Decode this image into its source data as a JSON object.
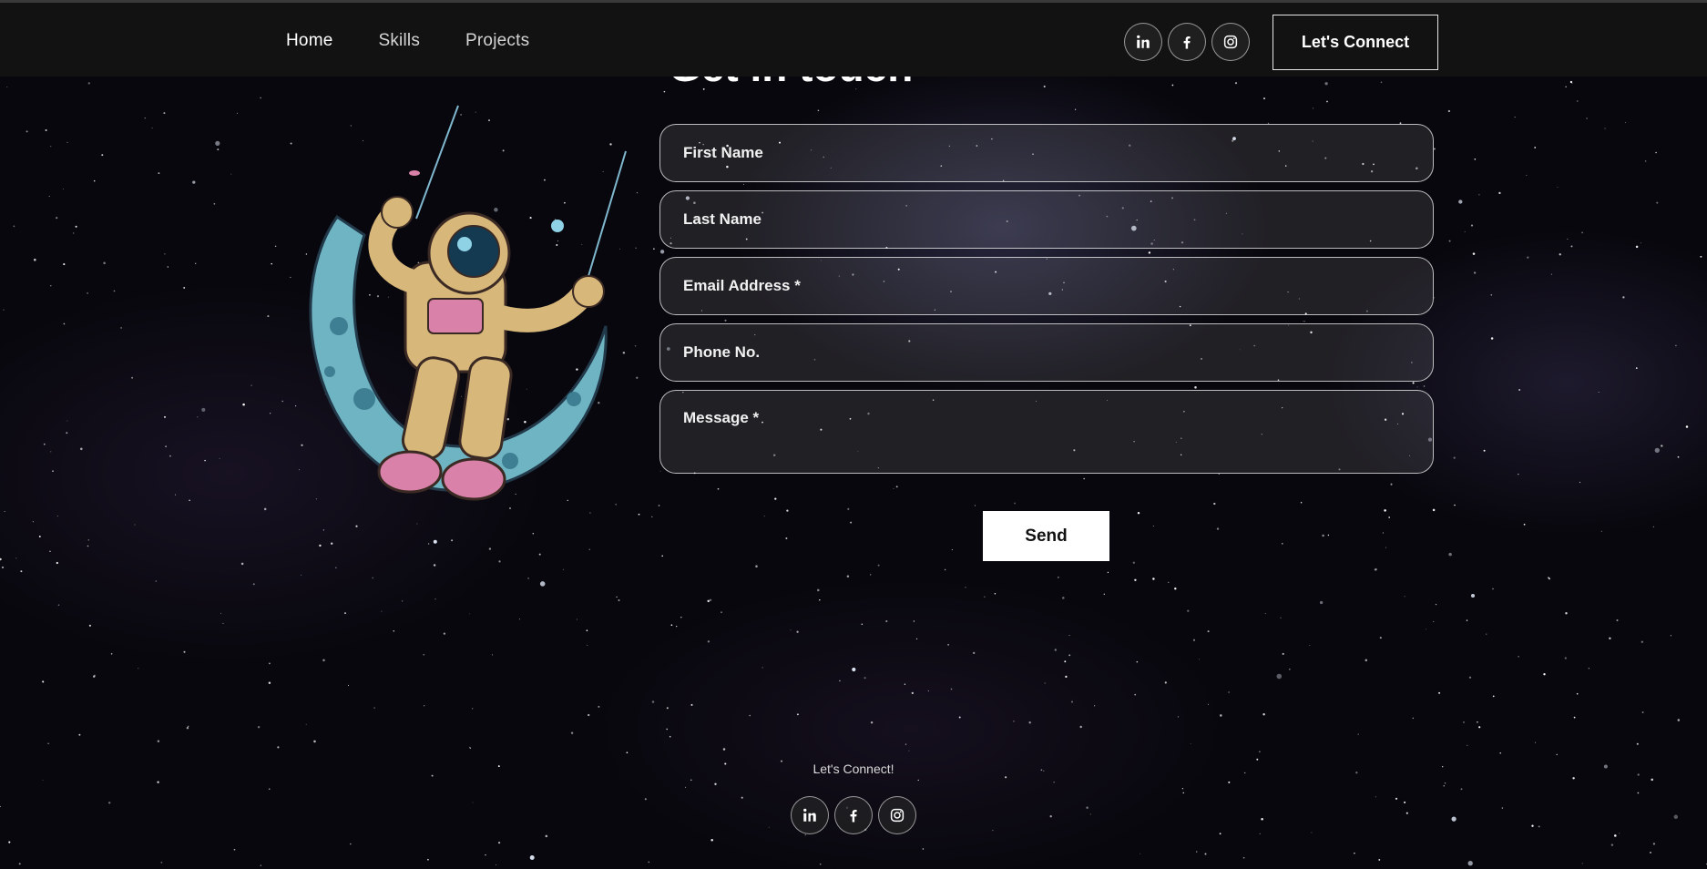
{
  "nav": {
    "links": [
      "Home",
      "Skills",
      "Projects"
    ],
    "active_index": 0,
    "social_icons": [
      "linkedin-icon",
      "facebook-icon",
      "instagram-icon"
    ],
    "connect_label": "Let's Connect"
  },
  "contact": {
    "title": "Get in touch",
    "fields": {
      "first_name": "First Name",
      "last_name": "Last Name",
      "email": "Email Address *",
      "phone": "Phone No.",
      "message": "Message *"
    },
    "send_label": "Send"
  },
  "footer": {
    "text": "Let's Connect!",
    "social_icons": [
      "linkedin-icon",
      "facebook-icon",
      "instagram-icon"
    ]
  },
  "colors": {
    "background": "#08070d",
    "header": "#121212",
    "button_bg": "#ffffff",
    "suit": "#d7b77a",
    "accent_pink": "#d981a8",
    "moon": "#6fb4c2"
  }
}
